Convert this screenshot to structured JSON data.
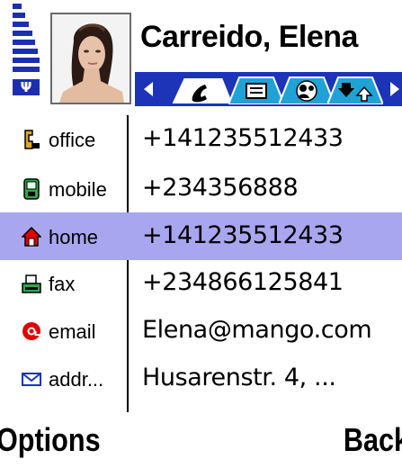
{
  "contact": {
    "name": "Carreido, Elena"
  },
  "status": {
    "signal_indicator": "Ψ"
  },
  "tabs": {
    "items": [
      {
        "icon": "phone-icon",
        "selected": true
      },
      {
        "icon": "text-detail-icon",
        "selected": false
      },
      {
        "icon": "group-icon",
        "selected": false
      },
      {
        "icon": "transfer-icon",
        "selected": false
      }
    ]
  },
  "fields": [
    {
      "label": "office",
      "value": "+141235512433",
      "icon": "office-phone-icon",
      "selected": false
    },
    {
      "label": "mobile",
      "value": "+234356888",
      "icon": "mobile-phone-icon",
      "selected": false
    },
    {
      "label": "home",
      "value": "+141235512433",
      "icon": "home-icon",
      "selected": true
    },
    {
      "label": "fax",
      "value": "+234866125841",
      "icon": "fax-icon",
      "selected": false
    },
    {
      "label": "email",
      "value": "Elena@mango.com",
      "icon": "at-icon",
      "selected": false
    },
    {
      "label": "addr...",
      "value": "Husarenstr. 4, ...",
      "icon": "envelope-icon",
      "selected": false
    }
  ],
  "softkeys": {
    "left": "Options",
    "right": "Back"
  },
  "colors": {
    "accent": "#1d33b8",
    "selection": "#a8a6ee"
  }
}
